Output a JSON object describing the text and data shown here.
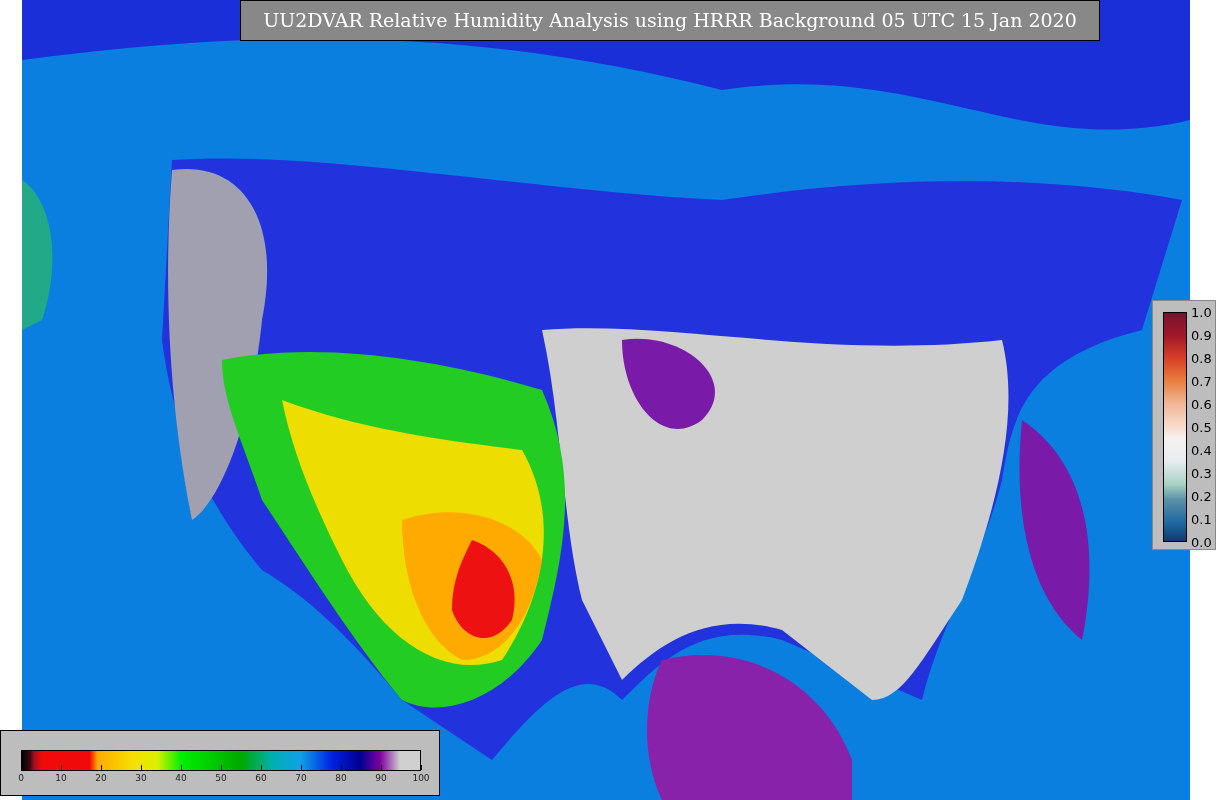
{
  "title": "UU2DVAR Relative Humidity Analysis using HRRR Background 05 UTC 15 Jan 2020",
  "humidity_legend": {
    "ticks": [
      "0",
      "10",
      "20",
      "30",
      "40",
      "50",
      "60",
      "70",
      "80",
      "90",
      "100"
    ]
  },
  "ratio_legend": {
    "ticks": [
      "1.0",
      "0.9",
      "0.8",
      "0.7",
      "0.6",
      "0.5",
      "0.4",
      "0.3",
      "0.2",
      "0.1",
      "0.0"
    ]
  }
}
